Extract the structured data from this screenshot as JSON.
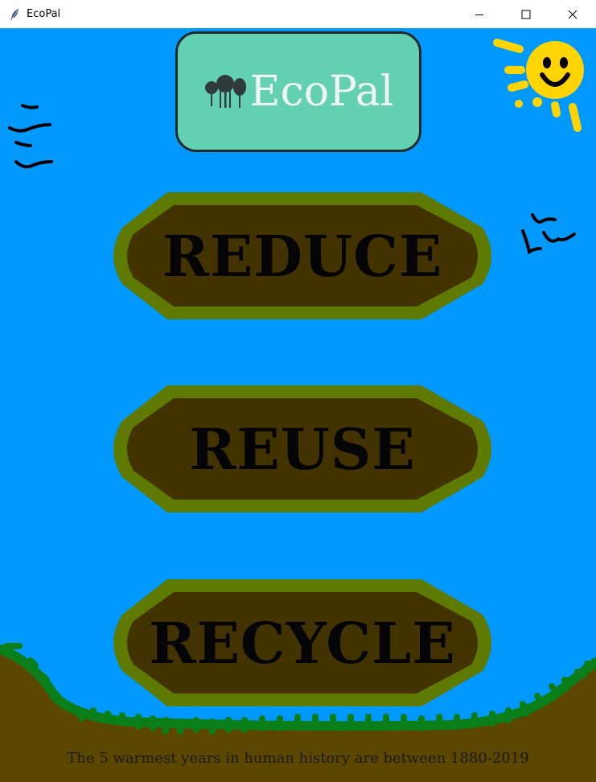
{
  "window": {
    "title": "EcoPal",
    "app_icon": "feather-icon",
    "controls": [
      "minimize-icon",
      "maximize-icon",
      "close-icon"
    ]
  },
  "logo": {
    "text": "EcoPal",
    "icon": "trees-icon",
    "background_color": "#63d1b1"
  },
  "buttons": {
    "reduce": "REDUCE",
    "reuse": "REUSE",
    "recycle": "RECYCLE"
  },
  "colors": {
    "sky": "#0099ff",
    "button_outer": "#5f7a00",
    "button_inner": "#423300",
    "ground": "#5c4700",
    "grass": "#0a7f19",
    "sun": "#ffd400"
  },
  "decorations": [
    "sun-icon",
    "birds-icon"
  ],
  "footer": {
    "fact": "The 5 warmest years in human history are between 1880-2019"
  }
}
